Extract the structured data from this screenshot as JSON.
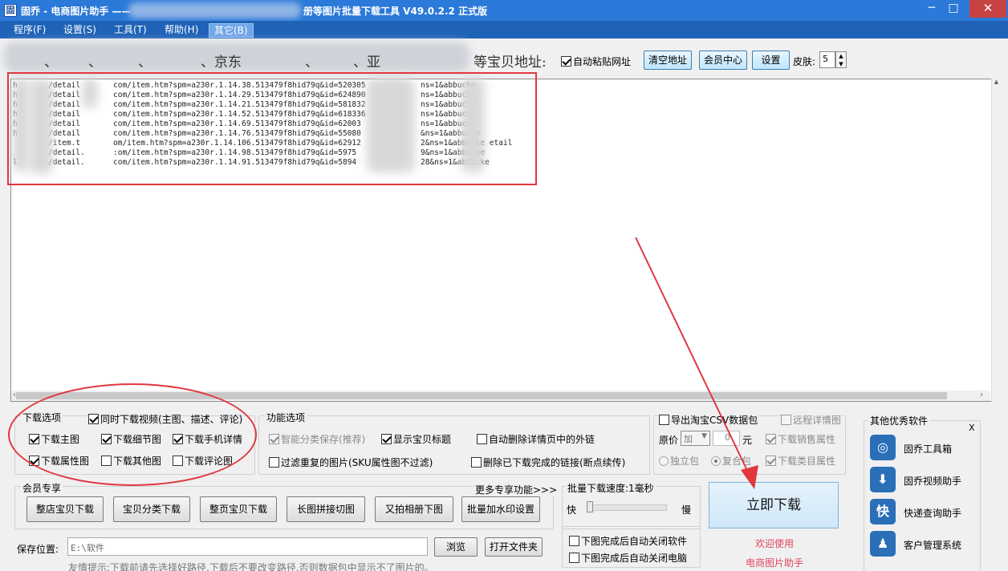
{
  "window": {
    "app_icon": "app-logo-icon",
    "title_left": "固乔 - 电商图片助手 ——",
    "title_right": "册等图片批量下载工具 V49.0.2.2 正式版",
    "minimize": "─",
    "maximize": "□",
    "close": "✕"
  },
  "menu": [
    "程序(F)",
    "设置(S)",
    "工具(T)",
    "帮助(H)",
    "其它(B)"
  ],
  "address_row": {
    "fragments": [
      "、",
      "、",
      "、",
      "、京东",
      "、",
      "、亚"
    ],
    "suffix_label": "等宝贝地址:",
    "auto_paste": {
      "label": "自动粘贴网址",
      "checked": true
    },
    "clear_button": "清空地址",
    "member_button": "会员中心",
    "settings_button": "设置",
    "skin_label": "皮肤:",
    "skin_value": "5"
  },
  "url_lines": [
    {
      "left": "h",
      "mid": "/detail",
      "right": "com/item.htm?spm=a230r.1.14.38.513479f8hid79q&id=520305",
      "tail": "ns=1&abbucke"
    },
    {
      "left": "h",
      "mid": "/detail",
      "right": "com/item.htm?spm=a230r.1.14.29.513479f8hid79q&id=624890",
      "tail": "ns=1&abbucke"
    },
    {
      "left": "h",
      "mid": "/detail",
      "right": "com/item.htm?spm=a230r.1.14.21.513479f8hid79q&id=581832",
      "tail": "ns=1&abbucke"
    },
    {
      "left": "h",
      "mid": "/detail",
      "right": "com/item.htm?spm=a230r.1.14.52.513479f8hid79q&id=618336",
      "tail": "ns=1&abbucke"
    },
    {
      "left": "h",
      "mid": "/detail",
      "right": "com/item.htm?spm=a230r.1.14.69.513479f8hid79q&id=62003",
      "tail": "ns=1&abbucke"
    },
    {
      "left": "h",
      "mid": "/detail",
      "right": "com/item.htm?spm=a230r.1.14.76.513479f8hid79q&id=55080",
      "tail": "&ns=1&abbucke"
    },
    {
      "left": "",
      "mid": "/item.t",
      "right": "om/item.htm?spm=a230r.1.14.106.513479f8hid79q&id=62912",
      "tail": "2&ns=1&abbucke    etail"
    },
    {
      "left": "",
      "mid": "/detail.",
      "right": ":om/item.htm?spm=a230r.1.14.98.513479f8hid79q&id=5975",
      "tail": "9&ns=1&abbucke"
    },
    {
      "left": "l",
      "mid": "/detail.",
      "right": "com/item.htm?spm=a230r.1.14.91.513479f8hid79q&id=5894",
      "tail": "28&ns=1&abbucke"
    }
  ],
  "download_options": {
    "title": "下载选项",
    "video": {
      "label": "同时下载视频(主图、描述、评论)",
      "checked": true
    },
    "items": [
      {
        "label": "下载主图",
        "checked": true
      },
      {
        "label": "下载细节图",
        "checked": true
      },
      {
        "label": "下载手机详情",
        "checked": true
      },
      {
        "label": "下载属性图",
        "checked": true
      },
      {
        "label": "下载其他图",
        "checked": false
      },
      {
        "label": "下载评论图",
        "checked": false
      }
    ]
  },
  "function_options": {
    "title": "功能选项",
    "smart_save": {
      "label": "智能分类保存(推荐)",
      "checked": true,
      "disabled": true
    },
    "show_title": {
      "label": "显示宝贝标题",
      "checked": true
    },
    "auto_delete_links": {
      "label": "自动删除详情页中的外链",
      "checked": false
    },
    "filter_dup": {
      "label": "过滤重复的图片(SKU属性图不过滤)",
      "checked": false
    },
    "delete_done": {
      "label": "删除已下载完成的链接(断点续传)",
      "checked": false
    }
  },
  "csv": {
    "export_label": "导出淘宝CSV数据包",
    "remote_label": "远程详情图",
    "price_label": "原价",
    "price_op": "加",
    "price_value": "0",
    "price_unit": "元",
    "sales_attr": "下载销售属性",
    "independent": "独立包",
    "composite": "复合包",
    "category_attr": "下载类目属性"
  },
  "member": {
    "title": "会员专享",
    "more": "更多专享功能>>>",
    "buttons": [
      "整店宝贝下载",
      "宝贝分类下载",
      "整页宝贝下载",
      "长图拼接切图",
      "又拍相册下图",
      "批量加水印设置"
    ]
  },
  "speed": {
    "title": "批量下载速度:1毫秒",
    "fast": "快",
    "slow": "慢",
    "slider_percent": 0,
    "close_software": "下图完成后自动关闭软件",
    "close_pc": "下图完成后自动关闭电脑"
  },
  "save": {
    "label": "保存位置:",
    "path": "E:\\软件",
    "browse": "浏览",
    "open_folder": "打开文件夹",
    "hint": "友情提示:下载前请先选择好路径,下载后不要改变路径,否则数据包中显示不了图片的。"
  },
  "action": {
    "download_now": "立即下载",
    "welcome1": "欢迎使用",
    "welcome2": "电商图片助手"
  },
  "other_software": {
    "title": "其他优秀软件",
    "close": "X",
    "items": [
      {
        "label": "固乔工具箱",
        "icon": "toolbox-icon",
        "glyph": "◎"
      },
      {
        "label": "固乔视频助手",
        "icon": "video-download-icon",
        "glyph": "⬇"
      },
      {
        "label": "快递查询助手",
        "icon": "express-query-icon",
        "glyph": "快"
      },
      {
        "label": "客户管理系统",
        "icon": "customer-management-icon",
        "glyph": "♟"
      }
    ]
  },
  "colors": {
    "title_bar": "#2b79d8",
    "menu_bar": "#1f63b8",
    "annotation_red": "#e0383e",
    "welcome_pink": "#e0455f"
  }
}
